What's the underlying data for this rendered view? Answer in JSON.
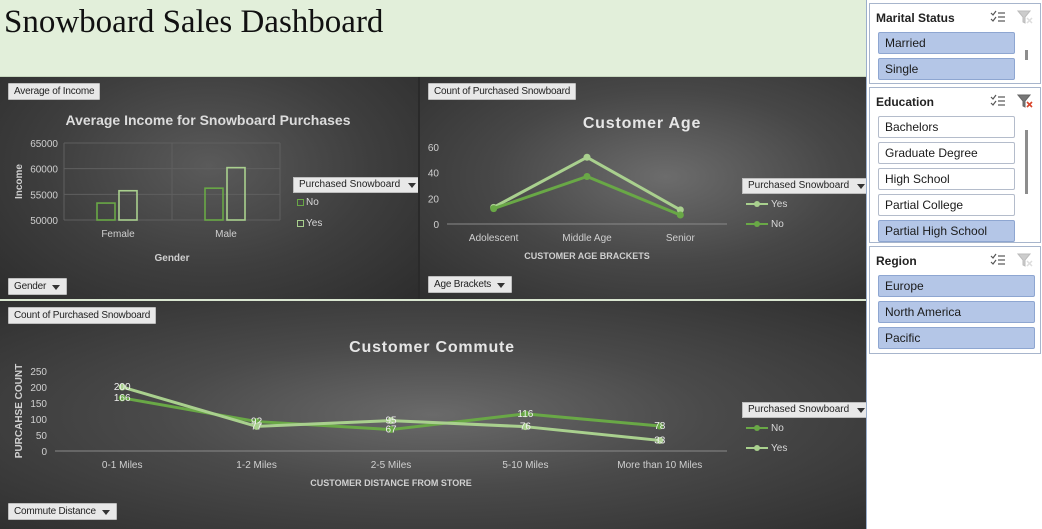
{
  "header": {
    "title": "Snowboard Sales Dashboard"
  },
  "colors": {
    "no": "#69a846",
    "yes": "#a9d08e",
    "header_bg": "#e2efda",
    "slicer_selected": "#b4c6e7"
  },
  "income_panel": {
    "value_button": "Average of Income",
    "axis_button": "Gender",
    "legend_title": "Purchased Snowboard",
    "chart_data": {
      "type": "bar",
      "title": "Average Income for Snowboard Purchases",
      "xlabel": "Gender",
      "ylabel": "Income",
      "categories": [
        "Female",
        "Male"
      ],
      "series": [
        {
          "name": "No",
          "values": [
            53300,
            56200
          ]
        },
        {
          "name": "Yes",
          "values": [
            55700,
            60200
          ]
        }
      ],
      "ylim": [
        50000,
        65000
      ],
      "yticks": [
        "50000",
        "55000",
        "60000",
        "65000"
      ],
      "grid": true,
      "legend": "right"
    }
  },
  "age_panel": {
    "value_button": "Count of Purchased Snowboard",
    "axis_button": "Age Brackets",
    "legend_title": "Purchased Snowboard",
    "chart_data": {
      "type": "line",
      "title": "Customer Age",
      "xlabel": "CUSTOMER AGE BRACKETS",
      "ylabel": "",
      "categories": [
        "Adolescent",
        "Middle Age",
        "Senior"
      ],
      "series": [
        {
          "name": "Yes",
          "values": [
            13,
            52,
            11
          ]
        },
        {
          "name": "No",
          "values": [
            12,
            37,
            7
          ]
        }
      ],
      "ylim": [
        0,
        60
      ],
      "yticks": [
        "0",
        "20",
        "40",
        "60"
      ],
      "grid": false,
      "legend": "right"
    }
  },
  "commute_panel": {
    "value_button": "Count of Purchased Snowboard",
    "axis_button": "Commute Distance",
    "legend_title": "Purchased Snowboard",
    "chart_data": {
      "type": "line",
      "title": "Customer Commute",
      "xlabel": "CUSTOMER DISTANCE FROM STORE",
      "ylabel": "PURCAHSE COUNT",
      "categories": [
        "0-1 Miles",
        "1-2 Miles",
        "2-5 Miles",
        "5-10 Miles",
        "More than 10 Miles"
      ],
      "series": [
        {
          "name": "No",
          "values": [
            166,
            92,
            67,
            116,
            78
          ]
        },
        {
          "name": "Yes",
          "values": [
            200,
            77,
            95,
            76,
            33
          ]
        }
      ],
      "ylim": [
        0,
        250
      ],
      "yticks": [
        "0",
        "50",
        "100",
        "150",
        "200",
        "250"
      ],
      "grid": false,
      "legend": "right"
    }
  },
  "slicers": {
    "marital": {
      "title": "Marital Status",
      "items": [
        {
          "label": "Married",
          "selected": true
        },
        {
          "label": "Single",
          "selected": true
        }
      ]
    },
    "education": {
      "title": "Education",
      "items": [
        {
          "label": "Bachelors",
          "selected": false
        },
        {
          "label": "Graduate Degree",
          "selected": false
        },
        {
          "label": "High School",
          "selected": false
        },
        {
          "label": "Partial College",
          "selected": false
        },
        {
          "label": "Partial High School",
          "selected": true
        }
      ]
    },
    "region": {
      "title": "Region",
      "items": [
        {
          "label": "Europe",
          "selected": true
        },
        {
          "label": "North America",
          "selected": true
        },
        {
          "label": "Pacific",
          "selected": true
        }
      ]
    }
  }
}
